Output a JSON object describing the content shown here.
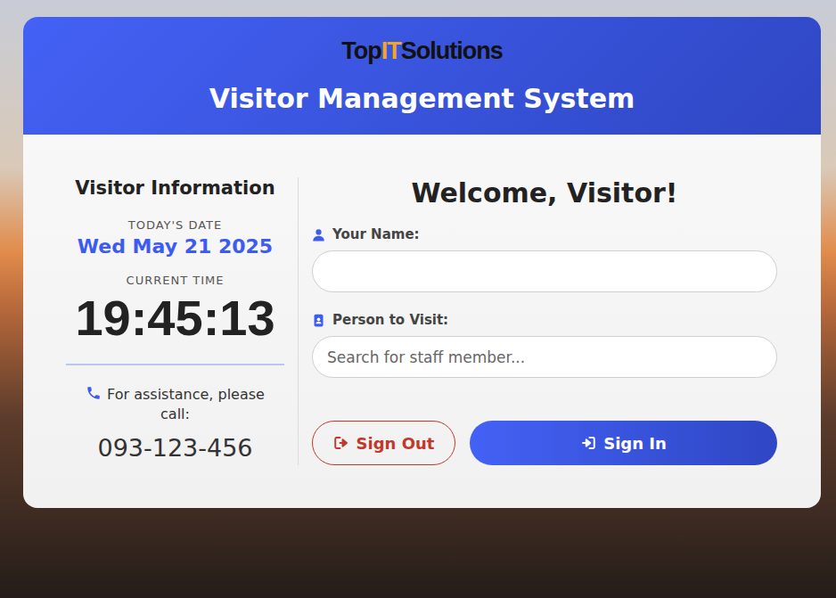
{
  "header": {
    "logo": [
      {
        "text": "Top",
        "color": "#111111"
      },
      {
        "text": "IT",
        "color": "#f2a623"
      },
      {
        "text": "Solutions",
        "color": "#111111"
      }
    ],
    "title": "Visitor Management System"
  },
  "info": {
    "title": "Visitor Information",
    "date_label": "TODAY'S DATE",
    "date": "Wed May 21 2025",
    "time_label": "CURRENT TIME",
    "time": "19:45:13",
    "assistance": "For assistance, please call:",
    "phone": "093-123-456"
  },
  "form": {
    "title": "Welcome, Visitor!",
    "fields": [
      {
        "label": "Your Name:",
        "placeholder": "",
        "value": "",
        "kind": "person"
      },
      {
        "label": "Person to Visit:",
        "placeholder": "Search for staff member...",
        "value": "",
        "kind": "contact"
      }
    ],
    "buttons": [
      {
        "label": "Sign Out",
        "kind": "secondary"
      },
      {
        "label": "Sign In",
        "kind": "primary"
      }
    ]
  }
}
